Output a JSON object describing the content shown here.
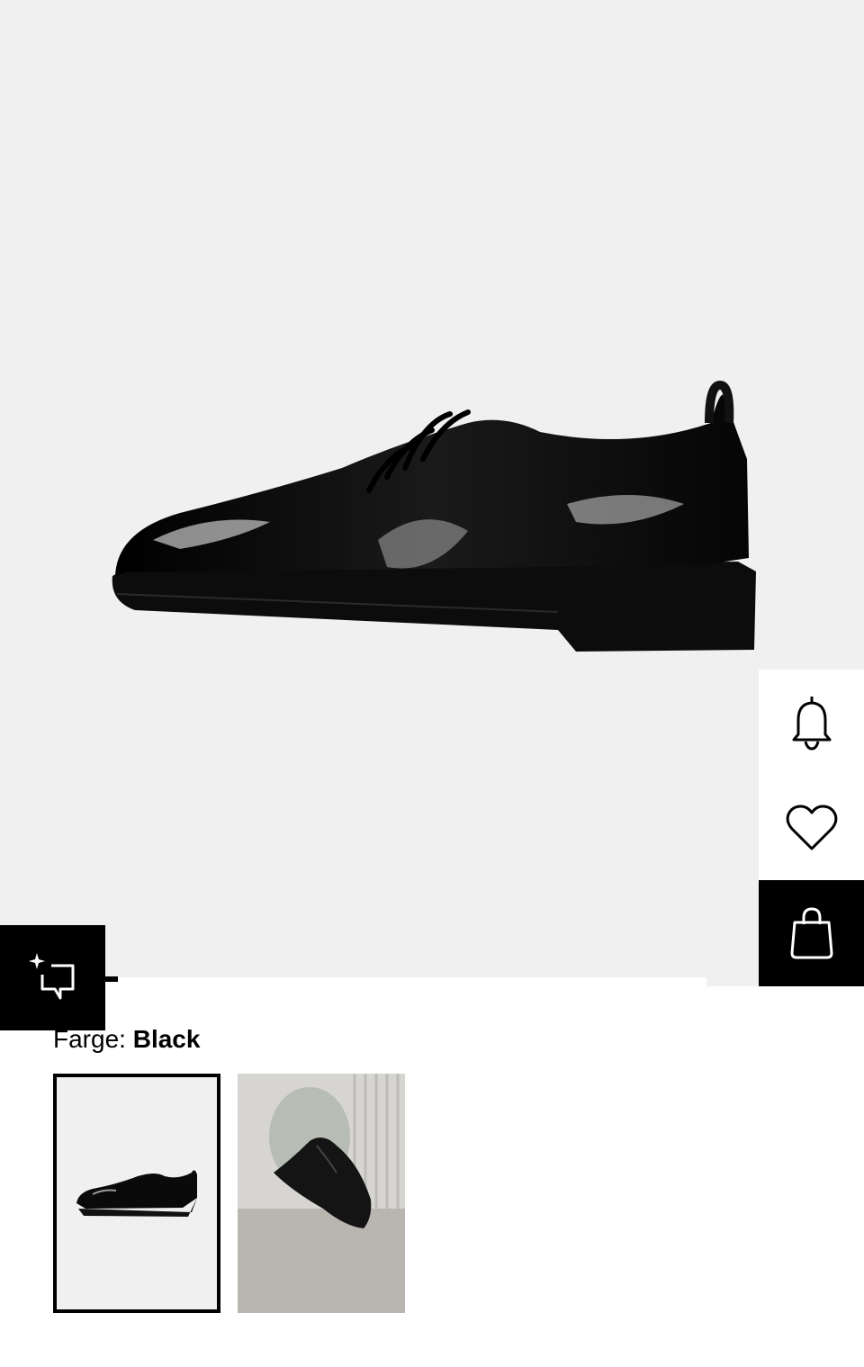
{
  "product": {
    "color_label": "Farge:",
    "color_value": "Black"
  },
  "actions": [
    {
      "name": "notify",
      "icon": "bell-icon"
    },
    {
      "name": "wishlist",
      "icon": "heart-icon"
    },
    {
      "name": "add-to-bag",
      "icon": "shopping-bag-icon"
    }
  ],
  "ai_button": {
    "icon": "sparkle-chat-icon"
  },
  "thumbnails": [
    {
      "name": "packshot",
      "selected": true
    },
    {
      "name": "lifestyle",
      "selected": false
    }
  ],
  "colors": {
    "hero_bg": "#f0f0f0",
    "accent": "#000000"
  }
}
